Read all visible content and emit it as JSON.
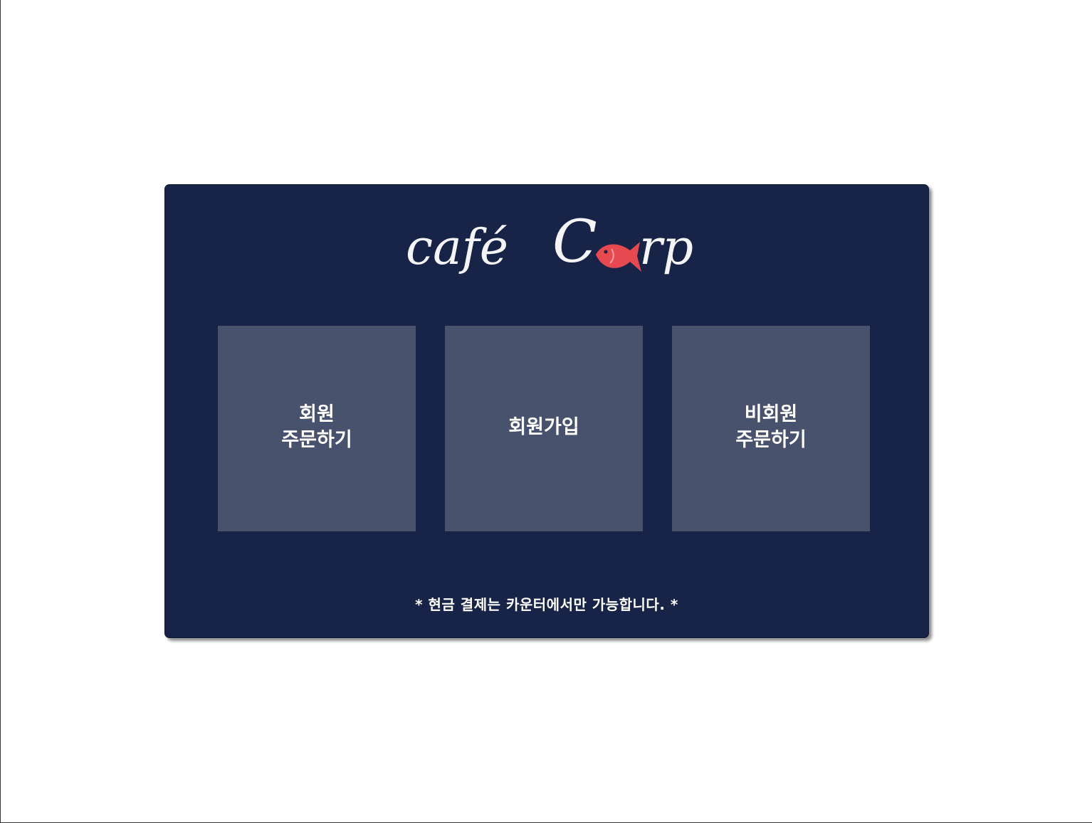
{
  "logo": {
    "part1": "café",
    "part2_letter": "C",
    "part2_rest": "rp",
    "fish_color": "#e8494f",
    "icon": "fish-icon"
  },
  "tiles": [
    {
      "line1": "회원",
      "line2": "주문하기"
    },
    {
      "line1": "회원가입",
      "line2": ""
    },
    {
      "line1": "비회원",
      "line2": "주문하기"
    }
  ],
  "notice": "* 현금 결제는 카운터에서만 가능합니다. *",
  "colors": {
    "panel_bg": "#172447",
    "tile_bg": "#48526d",
    "text": "#ffffff"
  }
}
